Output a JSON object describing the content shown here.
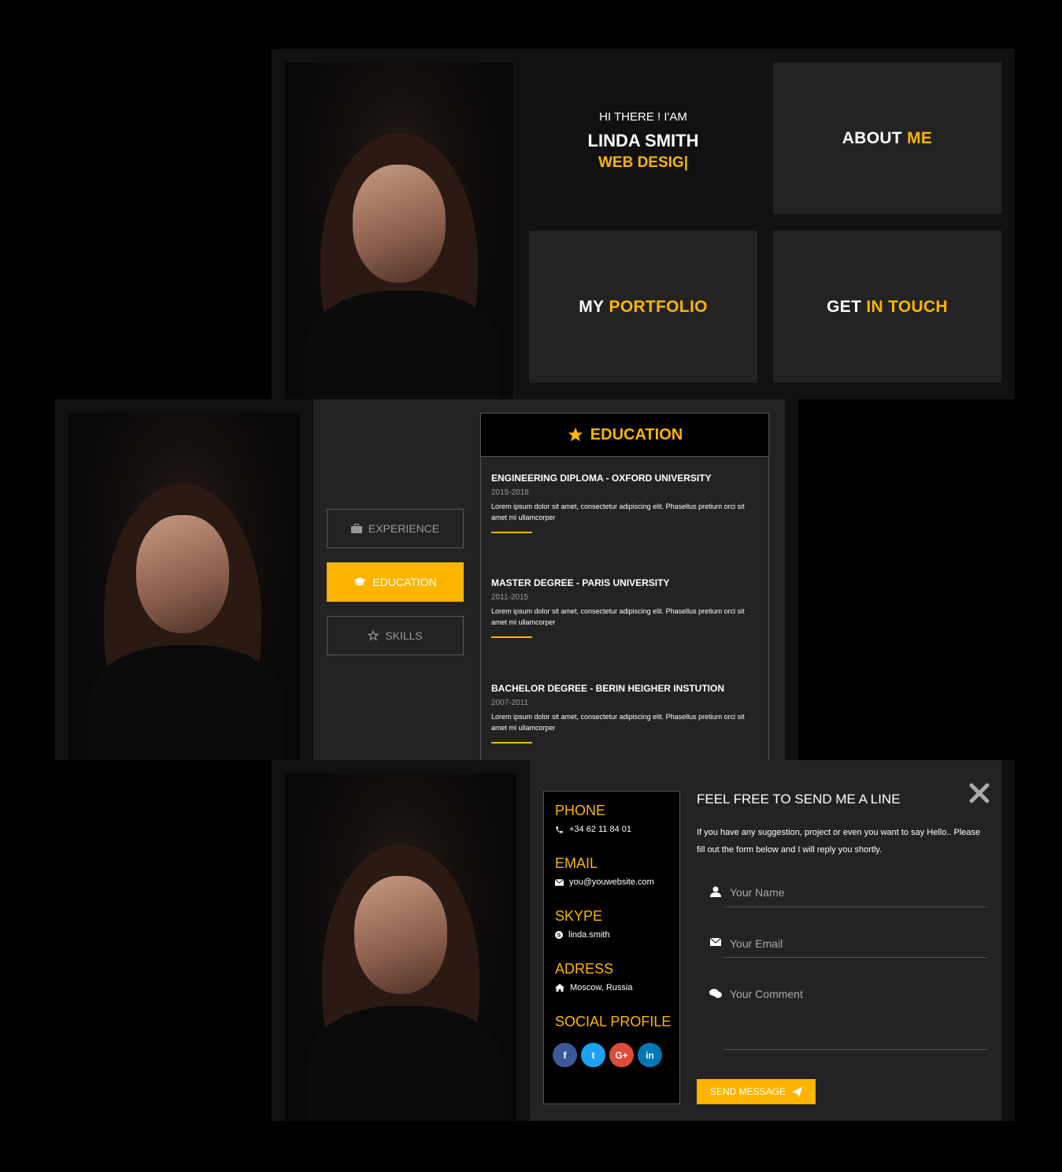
{
  "hero": {
    "greeting": "HI THERE ! I'AM",
    "name": "LINDA SMITH",
    "role": "WEB DESIG|"
  },
  "tiles": {
    "about": {
      "word1": "ABOUT",
      "word2": "ME"
    },
    "portfolio": {
      "word1": "MY",
      "word2": "PORTFOLIO"
    },
    "contact": {
      "word1": "GET",
      "word2": "IN TOUCH"
    }
  },
  "resume": {
    "tabs": [
      {
        "label": "EXPERIENCE",
        "icon": "briefcase-icon",
        "active": false
      },
      {
        "label": "EDUCATION",
        "icon": "graduation-cap-icon",
        "active": true
      },
      {
        "label": "SKILLS",
        "icon": "star-icon",
        "active": false
      }
    ],
    "panel_title": "EDUCATION",
    "panel_icon": "star-icon",
    "items": [
      {
        "title": "ENGINEERING DIPLOMA - OXFORD UNIVERSITY",
        "years": "2015-2018",
        "desc": "Lorem ipsum dolor sit amet, consectetur adipiscing elit. Phasellus pretium orci sit amet mi ullamcorper"
      },
      {
        "title": "MASTER DEGREE - PARIS UNIVERSITY",
        "years": "2011-2015",
        "desc": "Lorem ipsum dolor sit amet, consectetur adipiscing elit. Phasellus pretium orci sit amet mi ullamcorper"
      },
      {
        "title": "BACHELOR DEGREE - BERIN HEIGHER INSTUTION",
        "years": "2007-2011",
        "desc": "Lorem ipsum dolor sit amet, consectetur adipiscing elit. Phasellus pretium orci sit amet mi ullamcorper"
      }
    ]
  },
  "contact_info": {
    "phone_label": "PHONE",
    "phone": "+34 62 11 84 01",
    "email_label": "EMAIL",
    "email": "you@youwebsite.com",
    "skype_label": "SKYPE",
    "skype": "linda.smith",
    "address_label": "ADRESS",
    "address": "Moscow, Russia",
    "social_label": "SOCIAL PROFILE",
    "social": [
      {
        "icon": "facebook-icon",
        "glyph": "f",
        "color": "#3b5998"
      },
      {
        "icon": "twitter-icon",
        "glyph": "t",
        "color": "#1da1f2"
      },
      {
        "icon": "google-plus-icon",
        "glyph": "G+",
        "color": "#dd4b39"
      },
      {
        "icon": "linkedin-icon",
        "glyph": "in",
        "color": "#0077b5"
      }
    ]
  },
  "form": {
    "heading": "FEEL FREE TO SEND ME A LINE",
    "intro": "If you have any suggestion, project or even you want to say Hello.. Please fill out the form below and I will reply you shortly.",
    "name_placeholder": "Your Name",
    "email_placeholder": "Your Email",
    "comment_placeholder": "Your Comment",
    "submit_label": "SEND MESSAGE"
  },
  "colors": {
    "accent": "#ffb400",
    "panel": "#232323",
    "frame": "#111111"
  }
}
